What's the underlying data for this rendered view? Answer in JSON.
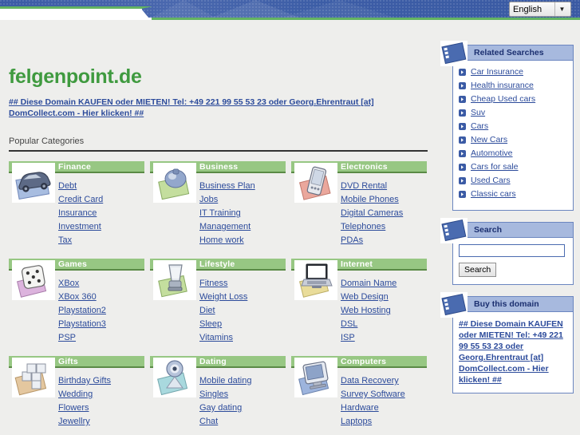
{
  "header": {
    "language_selected": "English",
    "dropdown_icon": "chevron-down-icon"
  },
  "site": {
    "title": "felgenpoint.de",
    "promo_text": "## Diese Domain KAUFEN oder MIETEN! Tel: +49 221 99 55 53 23 oder Georg.Ehrentraut [at] DomCollect.com - Hier klicken! ##",
    "popular_heading": "Popular Categories"
  },
  "colors": {
    "brand_green": "#3f9a3f",
    "category_header_green": "#97c783",
    "category_rule_green": "#5a8a46",
    "link_blue": "#2c4b9b",
    "panel_header_blue": "#a7b9de",
    "banner_blue": "#3b5ba5",
    "page_background": "#eeeeec"
  },
  "categories": [
    [
      {
        "title": "Finance",
        "icon": "car-icon",
        "links": [
          "Debt",
          "Credit Card",
          "Insurance",
          "Investment",
          "Tax"
        ]
      },
      {
        "title": "Business",
        "icon": "briefcase-icon",
        "links": [
          "Business Plan",
          "Jobs",
          "IT Training",
          "Management",
          "Home work"
        ]
      },
      {
        "title": "Electronics",
        "icon": "pda-icon",
        "links": [
          "DVD Rental",
          "Mobile Phones",
          "Digital Cameras",
          "Telephones",
          "PDAs"
        ]
      }
    ],
    [
      {
        "title": "Games",
        "icon": "dice-icon",
        "links": [
          "XBox",
          "XBox 360",
          "Playstation2",
          "Playstation3",
          "PSP"
        ]
      },
      {
        "title": "Lifestyle",
        "icon": "blender-icon",
        "links": [
          "Fitness",
          "Weight Loss",
          "Diet",
          "Sleep",
          "Vitamins"
        ]
      },
      {
        "title": "Internet",
        "icon": "laptop-icon",
        "links": [
          "Domain Name",
          "Web Design",
          "Web Hosting",
          "DSL",
          "ISP"
        ]
      }
    ],
    [
      {
        "title": "Gifts",
        "icon": "gift-boxes-icon",
        "links": [
          "Birthday Gifts",
          "Wedding",
          "Flowers",
          "Jewellry"
        ]
      },
      {
        "title": "Dating",
        "icon": "webcam-icon",
        "links": [
          "Mobile dating",
          "Singles",
          "Gay dating",
          "Chat"
        ]
      },
      {
        "title": "Computers",
        "icon": "monitor-icon",
        "links": [
          "Data Recovery",
          "Survey Software",
          "Hardware",
          "Laptops"
        ]
      }
    ]
  ],
  "sidebar": {
    "related_searches": {
      "title": "Related Searches",
      "icon": "note-card-icon",
      "bullet_icon": "arrow-right-icon",
      "items": [
        "Car Insurance",
        "Health insurance",
        "Cheap Used cars",
        "Suv",
        "Cars",
        "New Cars",
        "Automotive",
        "Cars for sale",
        "Used Cars",
        "Classic cars"
      ]
    },
    "search": {
      "title": "Search",
      "icon": "note-card-icon",
      "input_value": "",
      "input_placeholder": "",
      "button_label": "Search"
    },
    "buy_domain": {
      "title": "Buy this domain",
      "icon": "note-card-icon",
      "text": "## Diese Domain KAUFEN oder MIETEN! Tel: +49 221 99 55 53 23 oder Georg.Ehrentraut [at] DomCollect.com - Hier klicken! ##"
    }
  }
}
